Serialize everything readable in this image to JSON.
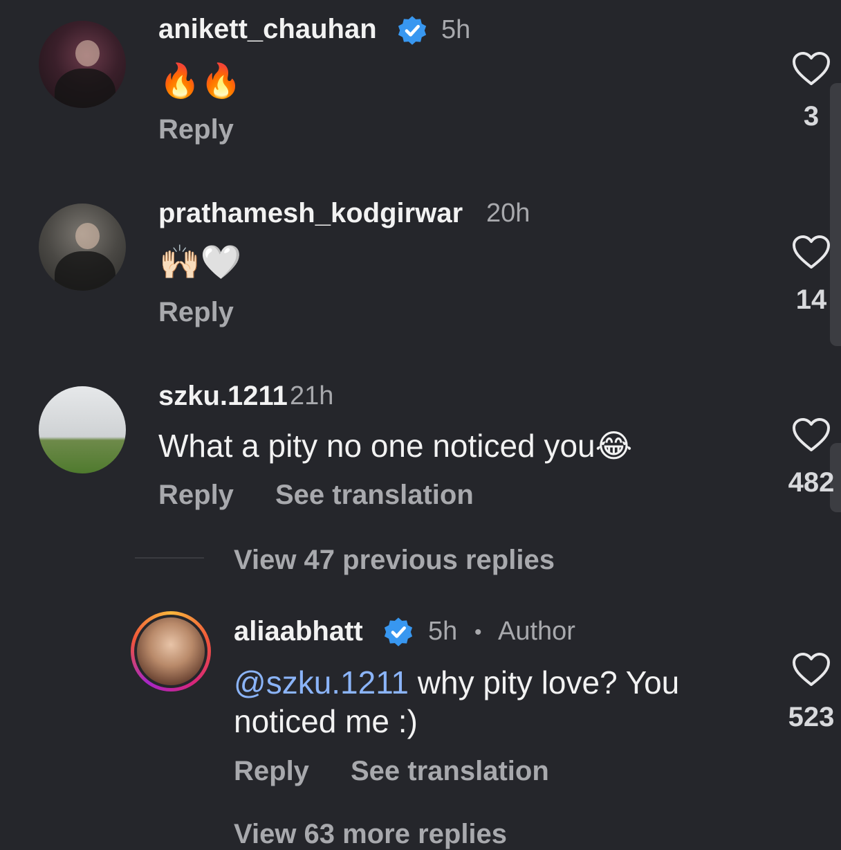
{
  "comments": [
    {
      "username": "anikett_chauhan",
      "verified": true,
      "time": "5h",
      "text": "🔥🔥",
      "reply_label": "Reply",
      "likes": "3",
      "avatar_icon": "user-avatar"
    },
    {
      "username": "prathamesh_kodgirwar",
      "verified": false,
      "time": "20h",
      "text": "🙌🏻🤍",
      "reply_label": "Reply",
      "likes": "14",
      "avatar_icon": "user-avatar"
    },
    {
      "username": "szku.1211",
      "verified": false,
      "time": "21h",
      "text": "What a pity no one noticed you😂",
      "reply_label": "Reply",
      "translate_label": "See translation",
      "likes": "482",
      "avatar_icon": "user-avatar"
    }
  ],
  "view_previous": "View 47 previous replies",
  "reply": {
    "username": "aliaabhatt",
    "verified": true,
    "time": "5h",
    "separator": "•",
    "author_label": "Author",
    "mention": "@szku.1211",
    "text_line1": " why pity love? You",
    "text_line2": "noticed me :)",
    "reply_label": "Reply",
    "translate_label": "See translation",
    "likes": "523",
    "avatar_icon": "story-ring-avatar"
  },
  "view_more": "View 63 more replies",
  "colors": {
    "background": "#25262b",
    "verified_badge": "#3897f0",
    "mention": "#8bb4f8",
    "secondary_text": "#a8a9ad"
  }
}
